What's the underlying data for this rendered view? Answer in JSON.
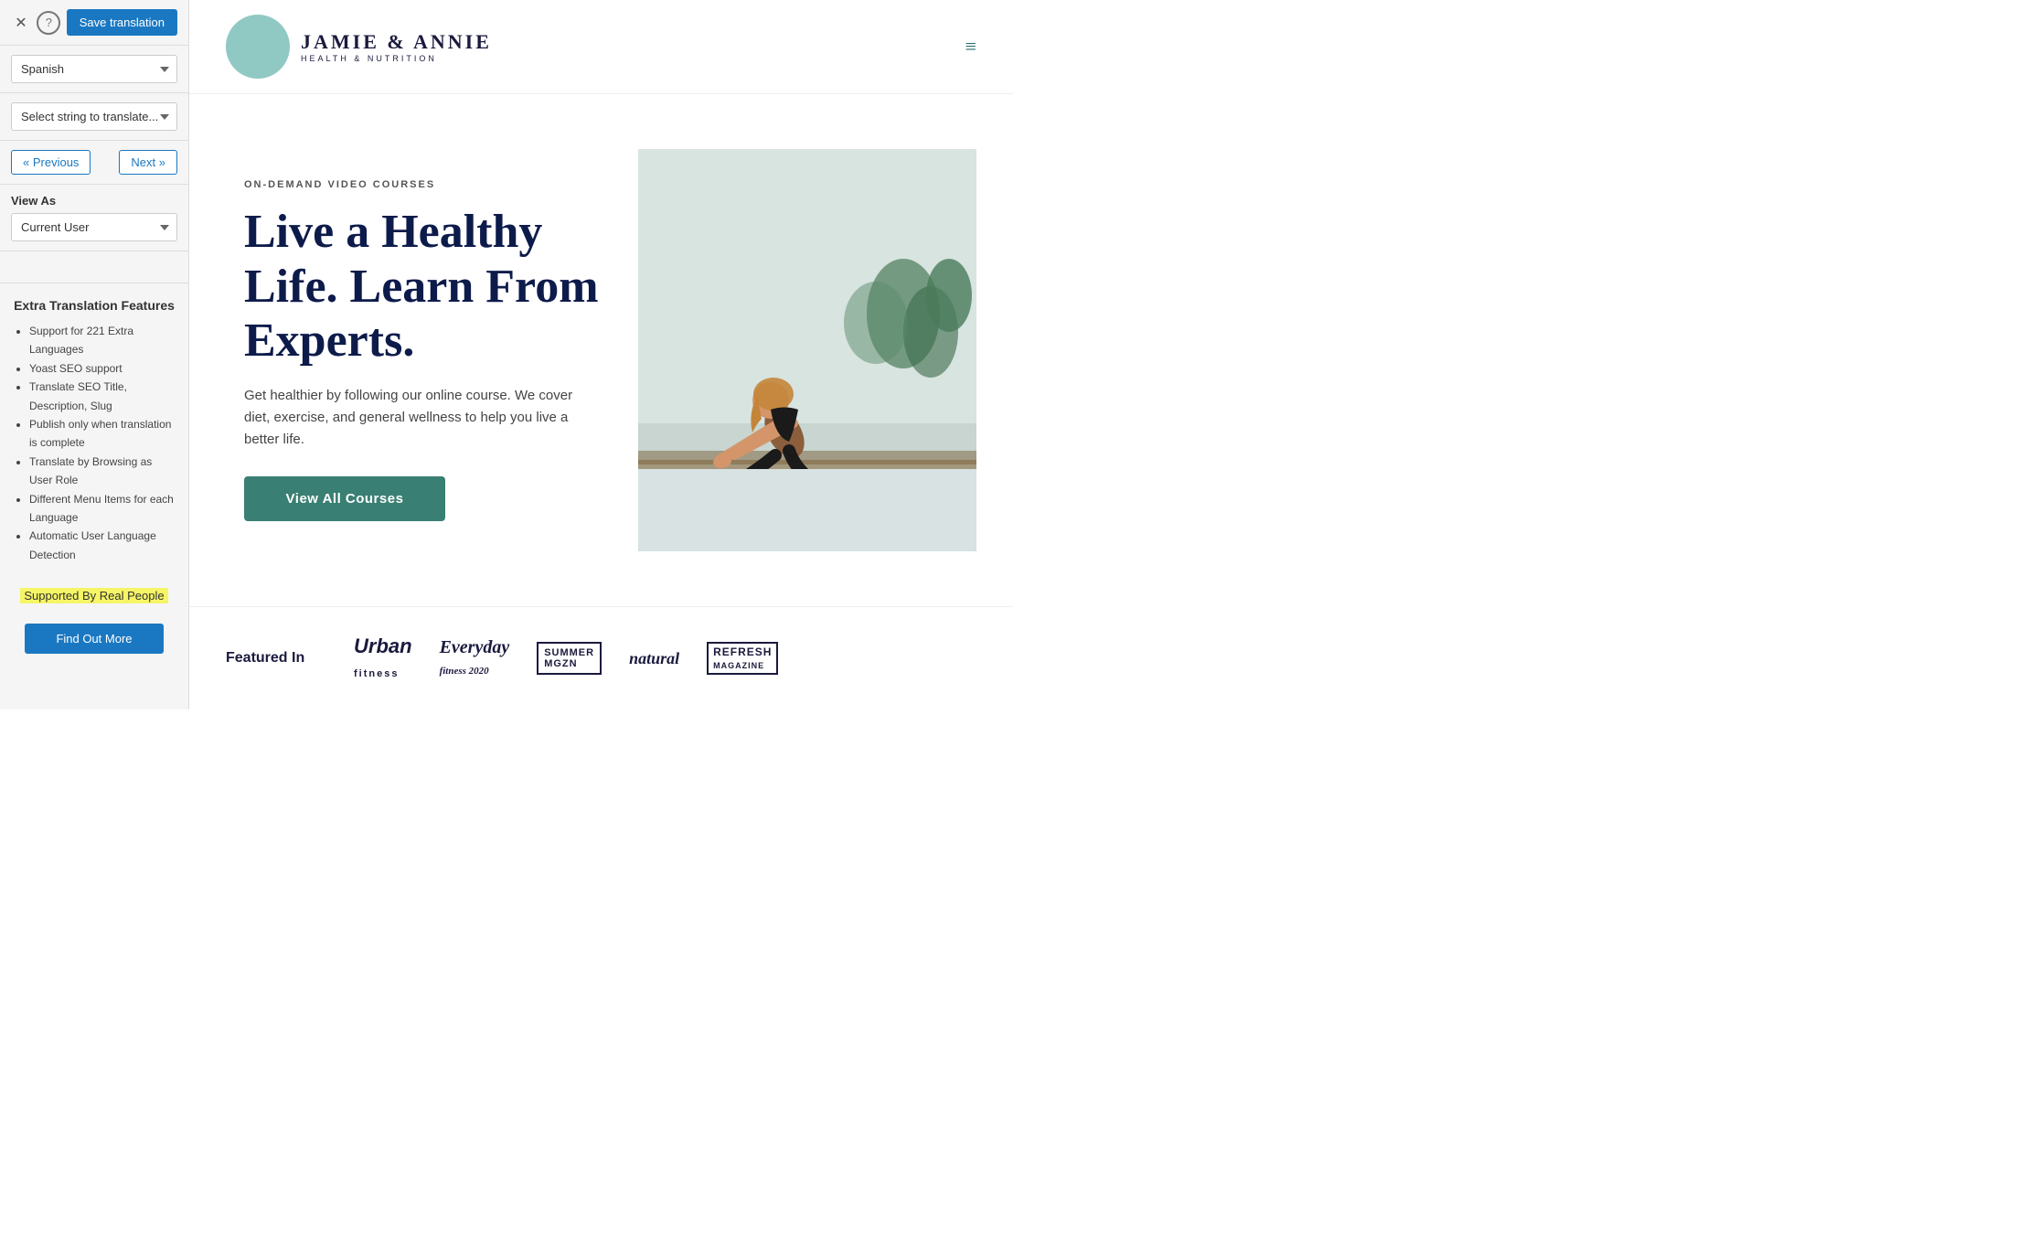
{
  "left_panel": {
    "close_label": "✕",
    "help_label": "?",
    "save_btn": "Save translation",
    "language_select": {
      "value": "Spanish",
      "placeholder": "Spanish"
    },
    "string_select": {
      "placeholder": "Select string to translate..."
    },
    "prev_btn": "« Previous",
    "next_btn": "Next »",
    "view_as_label": "View As",
    "current_user_select": {
      "value": "Current User"
    },
    "extra_features": {
      "title": "Extra Translation Features",
      "items": [
        "Support for 221 Extra Languages",
        "Yoast SEO support",
        "Translate SEO Title, Description, Slug",
        "Publish only when translation is complete",
        "Translate by Browsing as User Role",
        "Different Menu Items for each Language",
        "Automatic User Language Detection"
      ]
    },
    "supported_text": "Supported By Real People",
    "find_out_btn": "Find Out More"
  },
  "header": {
    "logo_main": "JAMIE & ANNIE",
    "logo_sub": "HEALTH & NUTRITION",
    "hamburger": "≡"
  },
  "hero": {
    "eyebrow": "ON-DEMAND VIDEO COURSES",
    "heading": "Live a Healthy Life. Learn From Experts.",
    "description": "Get healthier by following our online course. We cover diet, exercise, and general wellness to help you live a better life.",
    "cta_btn": "View All Courses"
  },
  "featured": {
    "label": "Featured In",
    "brands": [
      {
        "name": "Urban Fitness",
        "class": "urban",
        "display": "Urban\nfitness"
      },
      {
        "name": "Everyday Fitness 2020",
        "class": "everyday",
        "display": "Everyday\nfitness 2020"
      },
      {
        "name": "Summer MGZN",
        "class": "summer",
        "display": "SUMMER\nMGZN"
      },
      {
        "name": "Natural Magazine",
        "class": "natural",
        "display": "natural"
      },
      {
        "name": "Refresh Magazine",
        "class": "refresh",
        "display": "REFRESH\nMAGAZINE"
      }
    ]
  }
}
